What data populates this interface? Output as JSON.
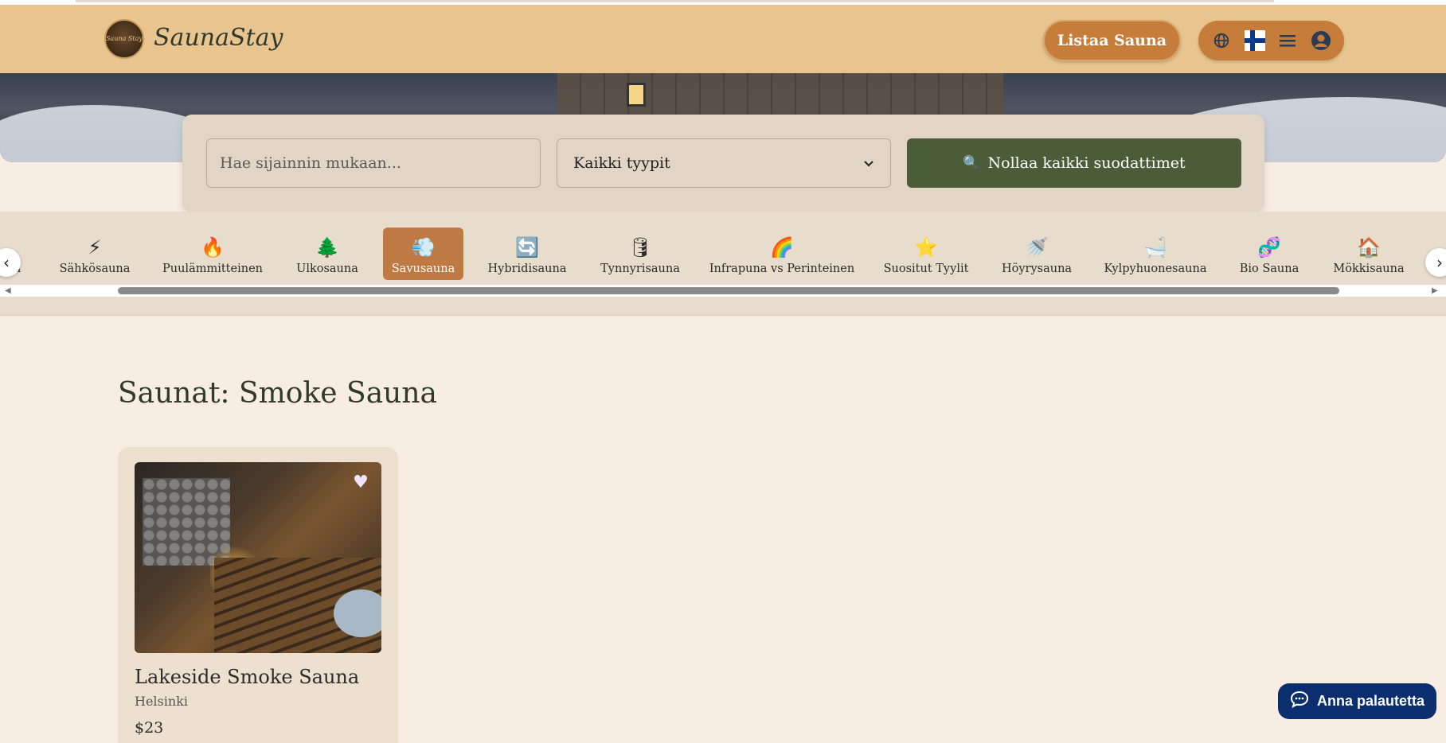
{
  "header": {
    "brand": "SaunaStay",
    "logo_text": "Sauna Stay",
    "list_button": "Listaa Sauna",
    "icons": [
      "globe-icon",
      "finland-flag-icon",
      "menu-icon",
      "user-icon"
    ]
  },
  "search": {
    "placeholder": "Hae sijainnin mukaan...",
    "type_selected": "Kaikki tyypit",
    "reset_label": "Nollaa kaikki suodattimet",
    "reset_icon": "🔍"
  },
  "categories": {
    "partial_left": "a",
    "items": [
      {
        "label": "Sähkösauna",
        "icon": "⚡"
      },
      {
        "label": "Puulämmitteinen",
        "icon": "🔥"
      },
      {
        "label": "Ulkosauna",
        "icon": "🌲"
      },
      {
        "label": "Savusauna",
        "icon": "💨"
      },
      {
        "label": "Hybridisauna",
        "icon": "🔄"
      },
      {
        "label": "Tynnyrisauna",
        "icon": "🛢"
      },
      {
        "label": "Infrapuna vs Perinteinen",
        "icon": "🌈"
      },
      {
        "label": "Suositut Tyylit",
        "icon": "⭐"
      },
      {
        "label": "Höyrysauna",
        "icon": "🚿"
      },
      {
        "label": "Kylpyhuonesauna",
        "icon": "🛁"
      },
      {
        "label": "Bio Sauna",
        "icon": "🧬"
      },
      {
        "label": "Mökkisauna",
        "icon": "🏠"
      }
    ],
    "active": "Savusauna"
  },
  "main": {
    "title": "Saunat: Smoke Sauna"
  },
  "listing": {
    "name": "Lakeside Smoke Sauna",
    "location": "Helsinki",
    "price": "$23"
  },
  "feedback": {
    "label": "Anna palautetta"
  },
  "colors": {
    "header_bg": "#e8c58f",
    "accent": "#c77d3a",
    "reset_button": "#4b5d38",
    "active_category": "#bf7a44",
    "feedback_button": "#0b2f6e",
    "page_bg": "#f7ede3"
  }
}
